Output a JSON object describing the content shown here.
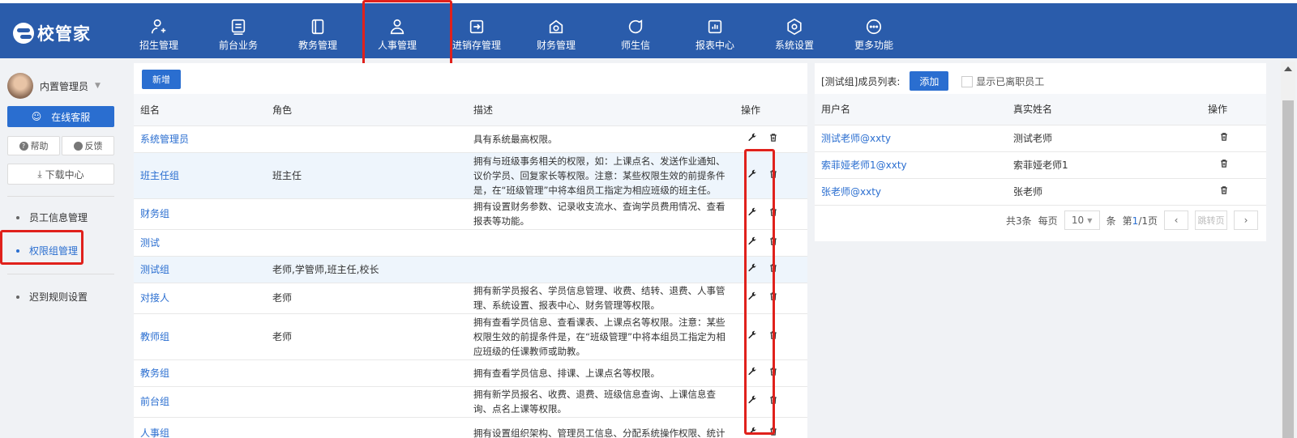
{
  "app": {
    "logo_text": "校管家"
  },
  "nav": [
    {
      "label": "招生管理",
      "icon": "user-add-icon"
    },
    {
      "label": "前台业务",
      "icon": "monitor-icon"
    },
    {
      "label": "教务管理",
      "icon": "book-icon"
    },
    {
      "label": "人事管理",
      "icon": "person-icon"
    },
    {
      "label": "进销存管理",
      "icon": "box-arrow-icon"
    },
    {
      "label": "财务管理",
      "icon": "finance-icon"
    },
    {
      "label": "师生信",
      "icon": "chat-icon"
    },
    {
      "label": "报表中心",
      "icon": "chart-icon"
    },
    {
      "label": "系统设置",
      "icon": "settings-icon"
    },
    {
      "label": "更多功能",
      "icon": "more-icon"
    }
  ],
  "sidebar": {
    "user_name": "内置管理员",
    "online_service": "在线客服",
    "help": "帮助",
    "feedback": "反馈",
    "download": "下载中心",
    "items": [
      "员工信息管理",
      "权限组管理",
      "迟到规则设置"
    ]
  },
  "roles": {
    "add_label": "新增",
    "columns": [
      "组名",
      "角色",
      "描述",
      "操作"
    ],
    "rows": [
      {
        "name": "系统管理员",
        "role": "",
        "desc": "具有系统最高权限。"
      },
      {
        "name": "班主任组",
        "role": "班主任",
        "desc": "拥有与班级事务相关的权限，如：上课点名、发送作业通知、议价学员、回复家长等权限。注意：某些权限生效的前提条件是，在“班级管理”中将本组员工指定为相应班级的班主任。"
      },
      {
        "name": "财务组",
        "role": "",
        "desc": "拥有设置财务参数、记录收支流水、查询学员费用情况、查看报表等功能。"
      },
      {
        "name": "测试",
        "role": "",
        "desc": ""
      },
      {
        "name": "测试组",
        "role": "老师,学管师,班主任,校长",
        "desc": ""
      },
      {
        "name": "对接人",
        "role": "老师",
        "desc": "拥有新学员报名、学员信息管理、收费、结转、退费、人事管理、系统设置、报表中心、财务管理等权限。"
      },
      {
        "name": "教师组",
        "role": "老师",
        "desc": "拥有查看学员信息、查看课表、上课点名等权限。注意：某些权限生效的前提条件是，在“班级管理”中将本组员工指定为相应班级的任课教师或助教。"
      },
      {
        "name": "教务组",
        "role": "",
        "desc": "拥有查看学员信息、排课、上课点名等权限。"
      },
      {
        "name": "前台组",
        "role": "",
        "desc": "拥有新学员报名、收费、退费、班级信息查询、上课信息查询、点名上课等权限。"
      },
      {
        "name": "人事组",
        "role": "",
        "desc": "拥有设置组织架构、管理员工信息、分配系统操作权限、统计"
      }
    ]
  },
  "members": {
    "title": "[测试组]成员列表:",
    "add_label": "添加",
    "show_resigned": "显示已离职员工",
    "columns": [
      "用户名",
      "真实姓名",
      "操作"
    ],
    "rows": [
      {
        "user": "测试老师@xxty",
        "real": "测试老师"
      },
      {
        "user": "索菲娅老师1@xxty",
        "real": "索菲娅老师1"
      },
      {
        "user": "张老师@xxty",
        "real": "张老师"
      }
    ],
    "pager": {
      "total": "共3条",
      "per_page_label": "每页",
      "per_page": "10",
      "unit": "条",
      "page_prefix": "第",
      "page_current": "1",
      "page_total": "/1页",
      "jump": "跳转页"
    }
  },
  "colors": {
    "primary": "#2a5cab",
    "accent": "#2a6ed0",
    "highlight": "#e0211c"
  }
}
